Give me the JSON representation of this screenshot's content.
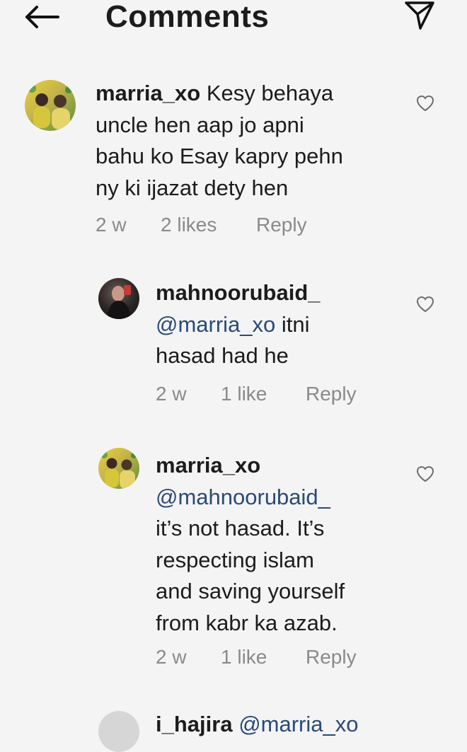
{
  "header": {
    "title": "Comments"
  },
  "comments": [
    {
      "username": "marria_xo",
      "body_first": "Kesy behaya",
      "body_rest": [
        "uncle hen aap jo apni",
        "bahu ko Esay kapry pehn",
        "ny ki ijazat dety hen"
      ],
      "time": "2 w",
      "likes": "2 likes",
      "reply": "Reply"
    },
    {
      "username": "mahnoorubaid_",
      "mention": "@marria_xo",
      "body_after_mention": "itni",
      "body_rest": [
        "hasad had he"
      ],
      "time": "2 w",
      "likes": "1 like",
      "reply": "Reply"
    },
    {
      "username": "marria_xo",
      "mention": "@mahnoorubaid_",
      "body_rest": [
        "it’s not hasad. It’s",
        "respecting islam",
        "and saving yourself",
        "from kabr ka azab."
      ],
      "time": "2 w",
      "likes": "1 like",
      "reply": "Reply"
    }
  ],
  "partial_comment": {
    "username": "i_hajira",
    "mention": "@marria_xo"
  }
}
